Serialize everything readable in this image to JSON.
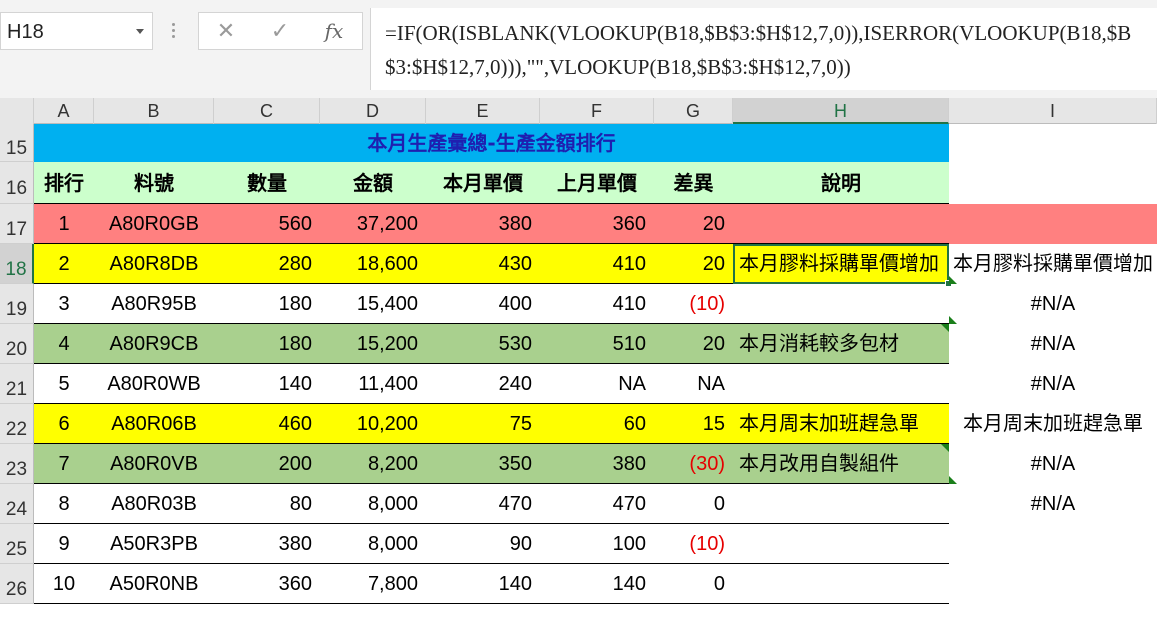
{
  "formula_bar": {
    "name_box": "H18",
    "cancel_icon": "✕",
    "enter_icon": "✓",
    "fx_label": "fx",
    "formula": "=IF(OR(ISBLANK(VLOOKUP(B18,$B$3:$H$12,7,0)),ISERROR(VLOOKUP(B18,$B$3:$H$12,7,0))),\"\",VLOOKUP(B18,$B$3:$H$12,7,0))"
  },
  "columns": [
    "A",
    "B",
    "C",
    "D",
    "E",
    "F",
    "G",
    "H",
    "I"
  ],
  "selected_column": "H",
  "selected_row": "18",
  "colors": {
    "title_bg": "#00b0f0",
    "header_bg": "#ccffcc",
    "red_row": "#ff8080",
    "yellow_row": "#ffff00",
    "green_row": "#a9d08e",
    "negative_text": "#e60000",
    "selection": "#217346"
  },
  "sheet": {
    "title_row_number": "15",
    "title": "本月生產彙總-生產金額排行",
    "header_row_number": "16",
    "headers": [
      "排行",
      "料號",
      "數量",
      "金額",
      "本月單價",
      "上月單價",
      "差異",
      "說明"
    ],
    "rows": [
      {
        "row": "17",
        "fill": "red_row",
        "rank": "1",
        "part": "A80R0GB",
        "qty": "560",
        "amount": "37,200",
        "this_price": "380",
        "last_price": "360",
        "diff": "20",
        "diff_negative": false,
        "note": "",
        "col_i": ""
      },
      {
        "row": "18",
        "fill": "yellow_row",
        "rank": "2",
        "part": "A80R8DB",
        "qty": "280",
        "amount": "18,600",
        "this_price": "430",
        "last_price": "410",
        "diff": "20",
        "diff_negative": false,
        "note": "本月膠料採購單價增加",
        "col_i": "本月膠料採購單價增加"
      },
      {
        "row": "19",
        "fill": "none",
        "rank": "3",
        "part": "A80R95B",
        "qty": "180",
        "amount": "15,400",
        "this_price": "400",
        "last_price": "410",
        "diff": "(10)",
        "diff_negative": true,
        "note": "",
        "col_i": "#N/A"
      },
      {
        "row": "20",
        "fill": "green_row",
        "rank": "4",
        "part": "A80R9CB",
        "qty": "180",
        "amount": "15,200",
        "this_price": "530",
        "last_price": "510",
        "diff": "20",
        "diff_negative": false,
        "note": "本月消耗較多包材",
        "col_i": "#N/A"
      },
      {
        "row": "21",
        "fill": "none",
        "rank": "5",
        "part": "A80R0WB",
        "qty": "140",
        "amount": "11,400",
        "this_price": "240",
        "last_price": "NA",
        "diff": "NA",
        "diff_negative": false,
        "note": "",
        "col_i": "#N/A"
      },
      {
        "row": "22",
        "fill": "yellow_row",
        "rank": "6",
        "part": "A80R06B",
        "qty": "460",
        "amount": "10,200",
        "this_price": "75",
        "last_price": "60",
        "diff": "15",
        "diff_negative": false,
        "note": "本月周末加班趕急單",
        "col_i": "本月周末加班趕急單"
      },
      {
        "row": "23",
        "fill": "green_row",
        "rank": "7",
        "part": "A80R0VB",
        "qty": "200",
        "amount": "8,200",
        "this_price": "350",
        "last_price": "380",
        "diff": "(30)",
        "diff_negative": true,
        "note": "本月改用自製組件",
        "col_i": "#N/A"
      },
      {
        "row": "24",
        "fill": "none",
        "rank": "8",
        "part": "A80R03B",
        "qty": "80",
        "amount": "8,000",
        "this_price": "470",
        "last_price": "470",
        "diff": "0",
        "diff_negative": false,
        "note": "",
        "col_i": "#N/A"
      },
      {
        "row": "25",
        "fill": "none",
        "rank": "9",
        "part": "A50R3PB",
        "qty": "380",
        "amount": "8,000",
        "this_price": "90",
        "last_price": "100",
        "diff": "(10)",
        "diff_negative": true,
        "note": "",
        "col_i": ""
      },
      {
        "row": "26",
        "fill": "none",
        "rank": "10",
        "part": "A50R0NB",
        "qty": "360",
        "amount": "7,800",
        "this_price": "140",
        "last_price": "140",
        "diff": "0",
        "diff_negative": false,
        "note": "",
        "col_i": ""
      }
    ]
  }
}
